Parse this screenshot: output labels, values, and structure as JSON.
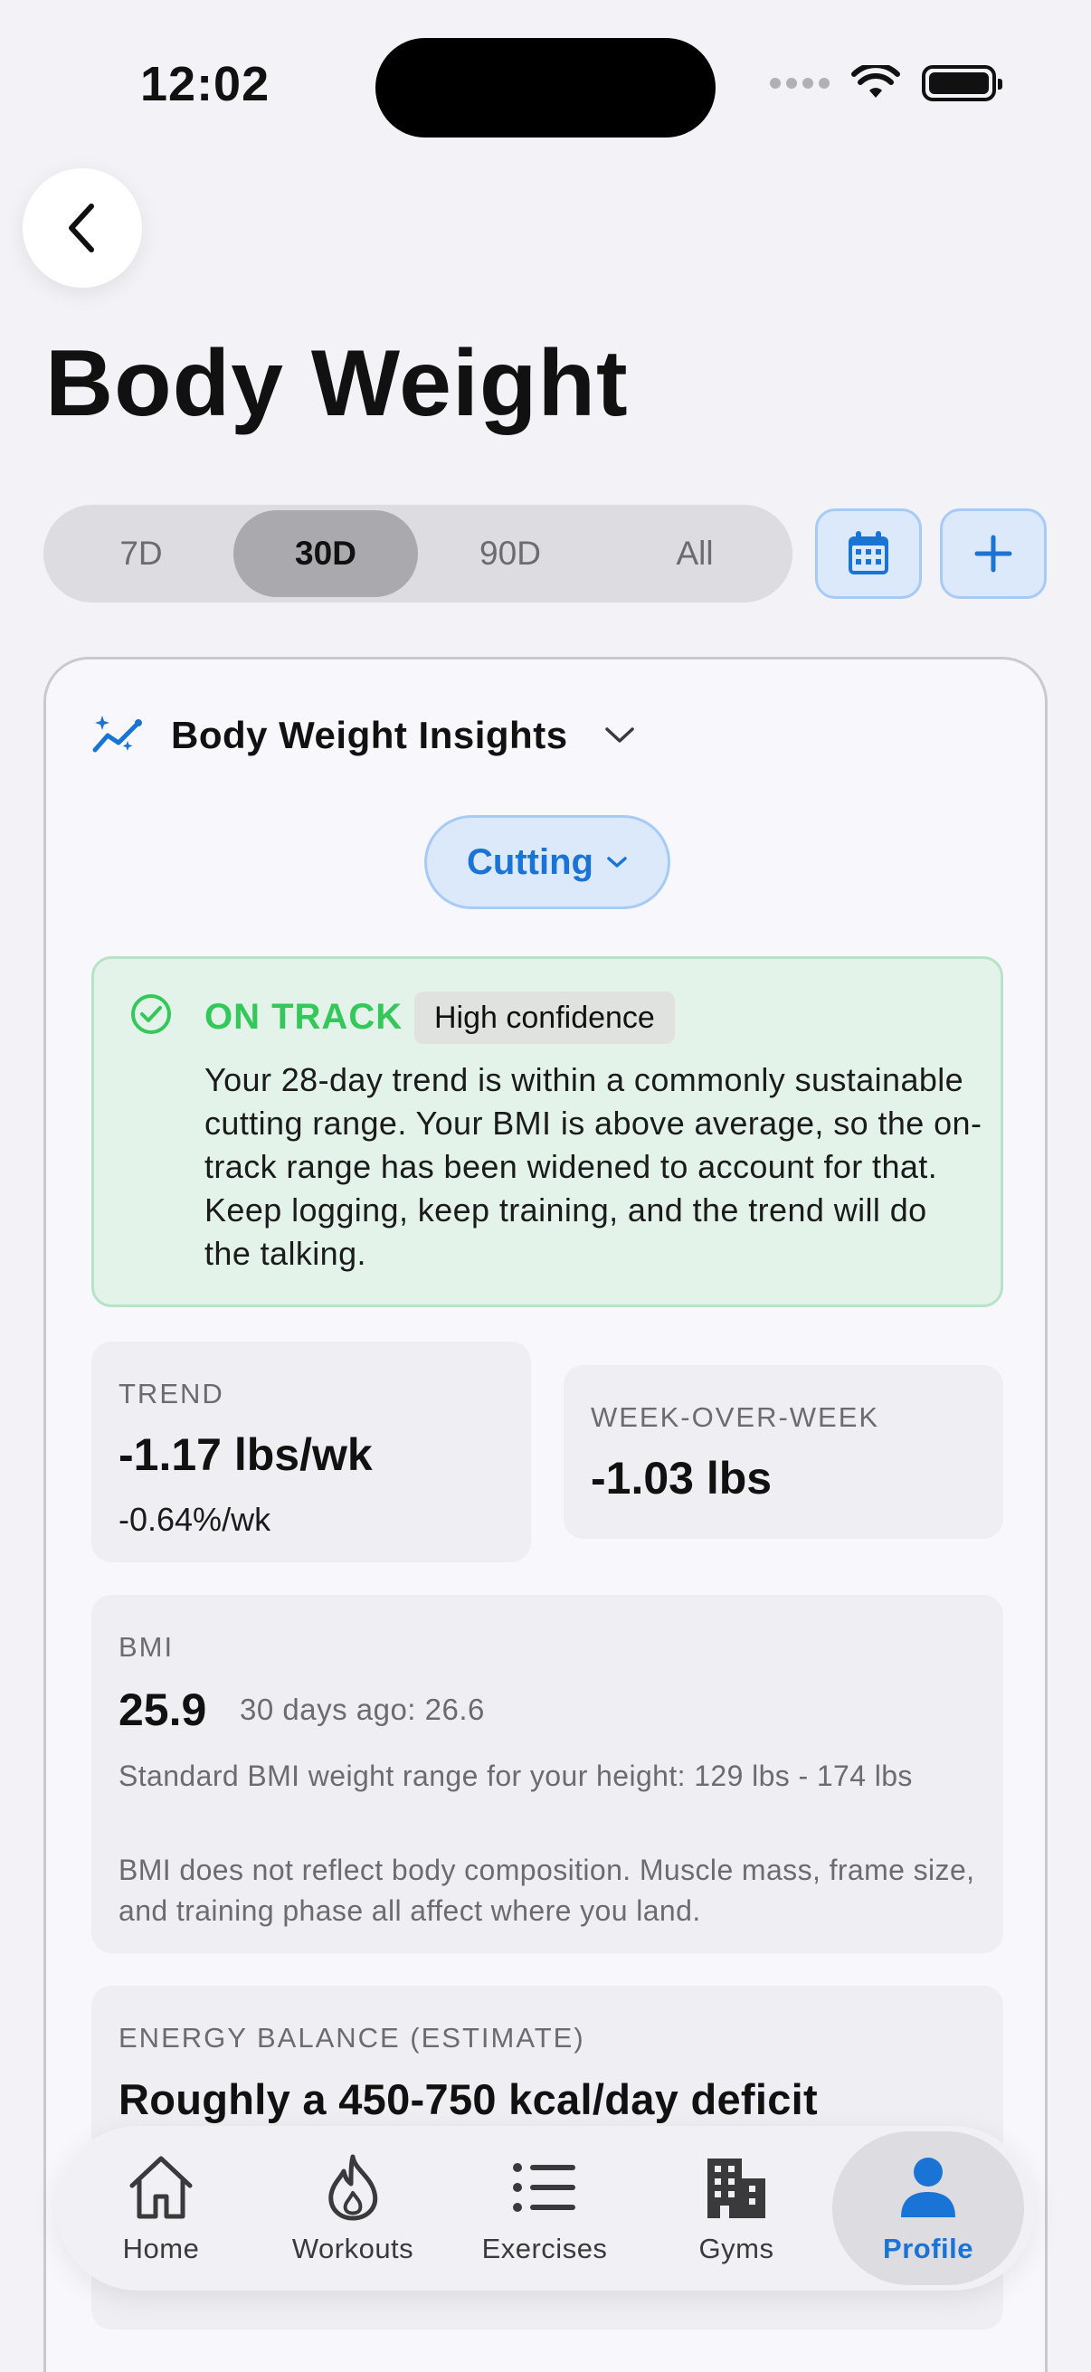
{
  "status": {
    "time": "12:02"
  },
  "header": {
    "title": "Body Weight"
  },
  "range": {
    "options": [
      "7D",
      "30D",
      "90D",
      "All"
    ],
    "selected": "30D"
  },
  "insights": {
    "title": "Body Weight Insights",
    "phase": "Cutting",
    "status": {
      "label": "ON TRACK",
      "confidence": "High confidence",
      "message": "Your 28-day trend is within a commonly sustainable cutting range. Your BMI is above average, so the on-track range has been widened to account for that. Keep logging, keep training, and the trend will do the talking."
    },
    "trend": {
      "label": "TREND",
      "value": "-1.17 lbs/wk",
      "sub": "-0.64%/wk"
    },
    "wow": {
      "label": "WEEK-OVER-WEEK",
      "value": "-1.03 lbs"
    },
    "bmi": {
      "label": "BMI",
      "value": "25.9",
      "ago": "30 days ago: 26.6",
      "range": "Standard BMI weight range for your height: 129 lbs - 174 lbs",
      "note": "BMI does not reflect body composition. Muscle mass, frame size, and training phase all affect where you land."
    },
    "energy": {
      "label": "ENERGY BALANCE (ESTIMATE)",
      "value": "Roughly a 450-750 kcal/day deficit"
    }
  },
  "tabs": [
    {
      "label": "Home",
      "icon": "house-icon"
    },
    {
      "label": "Workouts",
      "icon": "flame-icon"
    },
    {
      "label": "Exercises",
      "icon": "list-icon"
    },
    {
      "label": "Gyms",
      "icon": "building-icon"
    },
    {
      "label": "Profile",
      "icon": "person-icon",
      "active": true
    }
  ],
  "colors": {
    "accent": "#1a74d6",
    "success": "#34c759",
    "background": "#f2f2f7"
  }
}
